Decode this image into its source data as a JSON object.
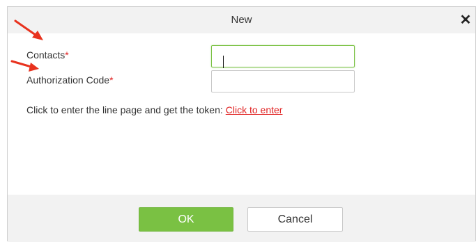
{
  "dialog": {
    "title": "New",
    "close_glyph": "✕"
  },
  "form": {
    "contacts_label": "Contacts",
    "contacts_value": "",
    "auth_code_label": "Authorization Code",
    "auth_code_value": "",
    "required_mark": "*",
    "token_text": "Click to enter the line page and get the token:",
    "token_link": "Click to enter"
  },
  "buttons": {
    "ok": "OK",
    "cancel": "Cancel"
  },
  "colors": {
    "accent_green": "#7ac143",
    "required_red": "#e02020",
    "annotation_arrow": "#e8321e"
  },
  "annotations": [
    "arrow-pointing-contacts",
    "arrow-pointing-authorization-code"
  ]
}
